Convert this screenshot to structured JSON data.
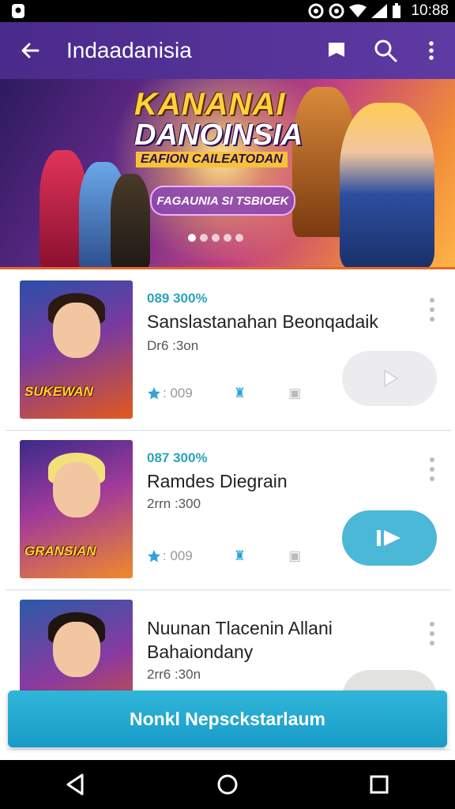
{
  "status_bar": {
    "time": "10:88"
  },
  "app_bar": {
    "title": "Indaadanisia"
  },
  "banner": {
    "title_line1": "KANANAI",
    "title_line2": "DANOINSIA",
    "subtitle": "EAFION CAILEATODAN",
    "button_label": "FAGAUNIA SI TSBIOEK",
    "dots_total": 5,
    "dots_active_index": 0
  },
  "items": [
    {
      "percent": "089 300%",
      "name": "Sanslastanahan Beonqadaik",
      "name_line2": "",
      "meta": "Dr6 :3on",
      "rating": ": 009",
      "thumb_label": "SUKEWAN"
    },
    {
      "percent": "087 300%",
      "name": "Ramdes Diegrain",
      "name_line2": "",
      "meta": "2rrn :300",
      "rating": ": 009",
      "thumb_label": "GRANSIAN"
    },
    {
      "percent": "",
      "name": "Nuunan Tlacenin Allani",
      "name_line2": "Bahaiondany",
      "meta": "2rr6 :30n",
      "rating": "",
      "thumb_label": ""
    }
  ],
  "cta": {
    "label": "Nonkl Nepsckstarlaum"
  },
  "colors": {
    "app_bar": "#4a2a8a",
    "accent_teal": "#2fb6d9",
    "percent_text": "#2ba4b8"
  },
  "icons": [
    "back-arrow-icon",
    "flag-icon",
    "search-icon",
    "more-vert-icon",
    "play-icon",
    "star-icon",
    "back-triangle-icon",
    "home-circle-icon",
    "recents-square-icon"
  ]
}
